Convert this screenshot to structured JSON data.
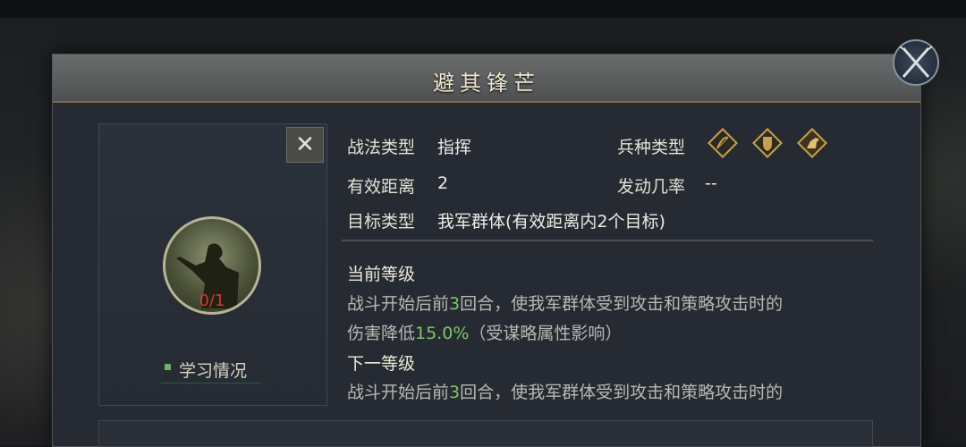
{
  "dialog": {
    "title": "避其锋芒"
  },
  "portrait": {
    "level": "0/1",
    "learn_label": "学习情况"
  },
  "close_button": {
    "symbol": "✕"
  },
  "props": {
    "type_label": "战法类型",
    "type_value": "指挥",
    "range_label": "有效距离",
    "range_value": "2",
    "target_label": "目标类型",
    "target_value": "我军群体(有效距离内2个目标)",
    "troop_label": "兵种类型",
    "rate_label": "发动几率",
    "rate_value": "--"
  },
  "troop_icons": [
    "bow-icon",
    "shield-icon",
    "horse-icon"
  ],
  "current": {
    "heading": "当前等级",
    "line1_pre": "战斗开始后前",
    "line1_num": "3",
    "line1_post": "回合，使我军群体受到攻击和策略攻击时的",
    "line2_pre": "伤害降低",
    "line2_num": "15.0%",
    "line2_post": "（受谋略属性影响）"
  },
  "next": {
    "heading": "下一等级",
    "line1_pre": "战斗开始后前",
    "line1_num": "3",
    "line1_post": "回合，使我军群体受到攻击和策略攻击时的"
  },
  "colors": {
    "accent_green": "#7fc46a",
    "level_red": "#d23a2a",
    "gold": "#c9a04a"
  }
}
